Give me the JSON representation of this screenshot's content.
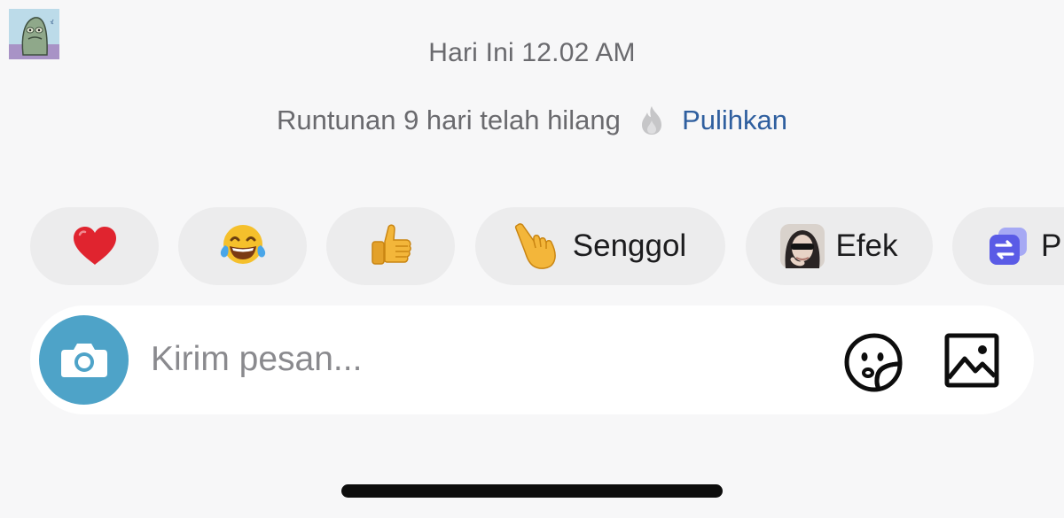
{
  "header": {
    "avatar_icon": "monster-avatar-icon"
  },
  "chat": {
    "timestamp": "Hari Ini 12.02 AM",
    "streak_text": "Runtunan 9 hari telah hilang",
    "streak_icon": "flame-icon",
    "restore_label": "Pulihkan",
    "restore_color": "#2f5f9f"
  },
  "reactions": {
    "heart": {
      "icon": "heart-icon",
      "color": "#e0242f"
    },
    "laugh": {
      "icon": "laughing-tears-icon"
    },
    "thumbs_up": {
      "icon": "thumbs-up-icon"
    },
    "nudge": {
      "icon": "pointing-hand-icon",
      "label": "Senggol"
    },
    "effect": {
      "icon": "effect-avatar-icon",
      "label": "Efek"
    },
    "partial": {
      "icon": "swap-app-icon",
      "label": "P"
    }
  },
  "composer": {
    "camera_icon": "camera-icon",
    "camera_color": "#4ea3c8",
    "placeholder": "Kirim pesan...",
    "sticker_icon": "sticker-icon",
    "gallery_icon": "image-icon"
  }
}
